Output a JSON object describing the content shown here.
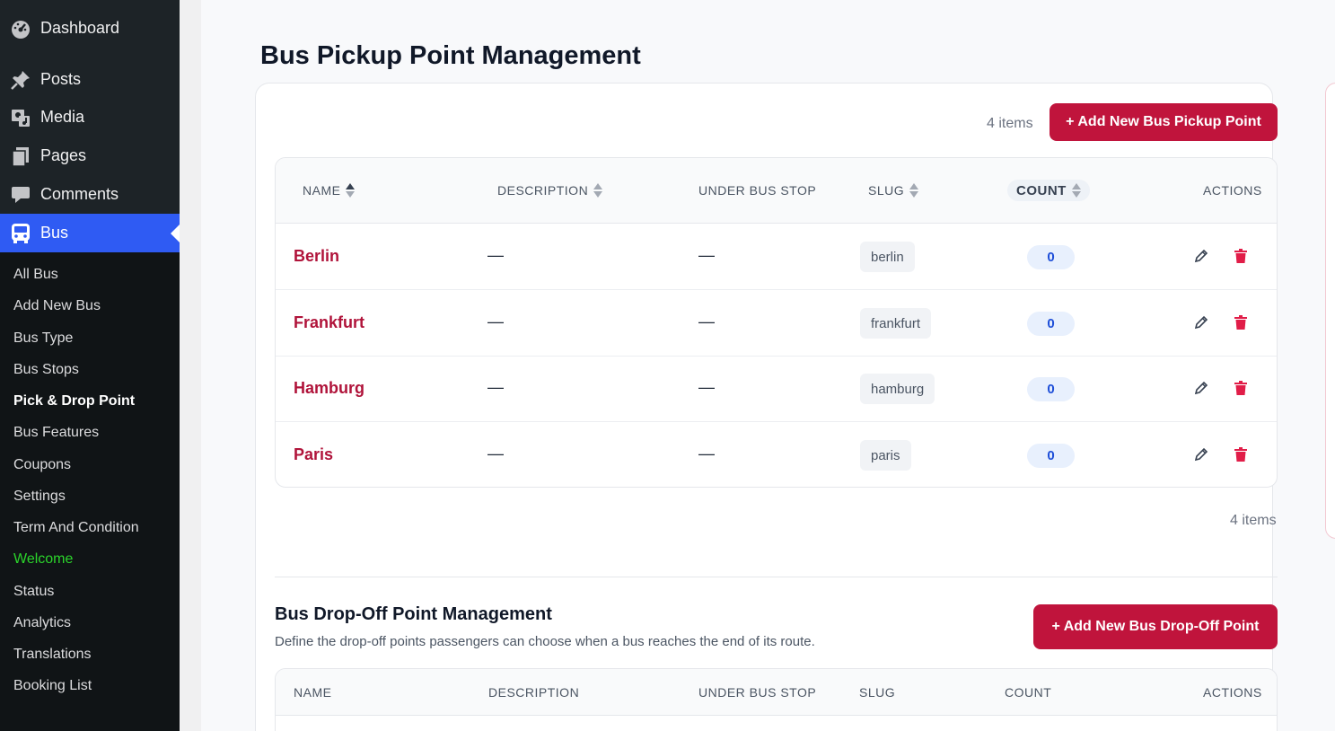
{
  "sidebar": {
    "menu": [
      {
        "label": "Dashboard",
        "icon": "dashboard-icon"
      },
      {
        "label": "Posts",
        "icon": "pin-icon"
      },
      {
        "label": "Media",
        "icon": "media-icon"
      },
      {
        "label": "Pages",
        "icon": "pages-icon"
      },
      {
        "label": "Comments",
        "icon": "comment-icon"
      },
      {
        "label": "Bus",
        "icon": "bus-icon"
      }
    ],
    "submenu": [
      "All Bus",
      "Add New Bus",
      "Bus Type",
      "Bus Stops",
      "Pick & Drop Point",
      "Bus Features",
      "Coupons",
      "Settings",
      "Term And Condition",
      "Welcome",
      "Status",
      "Analytics",
      "Translations",
      "Booking List"
    ],
    "active_submenu": "Pick & Drop Point",
    "accent_color": "#2f5bf3"
  },
  "pickup": {
    "title": "Bus Pickup Point Management",
    "items_count_top": "4 items",
    "items_count_bottom": "4 items",
    "add_button": "+ Add New Bus Pickup Point",
    "columns": {
      "name": "NAME",
      "description": "DESCRIPTION",
      "under_bus_stop": "UNDER BUS STOP",
      "slug": "SLUG",
      "count": "COUNT",
      "actions": "ACTIONS"
    },
    "rows": [
      {
        "name": "Berlin",
        "description": "—",
        "under_bus_stop": "—",
        "slug": "berlin",
        "count": "0"
      },
      {
        "name": "Frankfurt",
        "description": "—",
        "under_bus_stop": "—",
        "slug": "frankfurt",
        "count": "0"
      },
      {
        "name": "Hamburg",
        "description": "—",
        "under_bus_stop": "—",
        "slug": "hamburg",
        "count": "0"
      },
      {
        "name": "Paris",
        "description": "—",
        "under_bus_stop": "—",
        "slug": "paris",
        "count": "0"
      }
    ]
  },
  "dropoff": {
    "title": "Bus Drop-Off Point Management",
    "description": "Define the drop-off points passengers can choose when a bus reaches the end of its route.",
    "add_button": "+ Add New Bus Drop-Off Point",
    "columns": {
      "name": "NAME",
      "description": "DESCRIPTION",
      "under_bus_stop": "UNDER BUS STOP",
      "slug": "SLUG",
      "count": "COUNT",
      "actions": "ACTIONS"
    }
  },
  "colors": {
    "primary": "#c0143c",
    "name_link": "#b0133a",
    "count_text": "#1d4ed8"
  }
}
